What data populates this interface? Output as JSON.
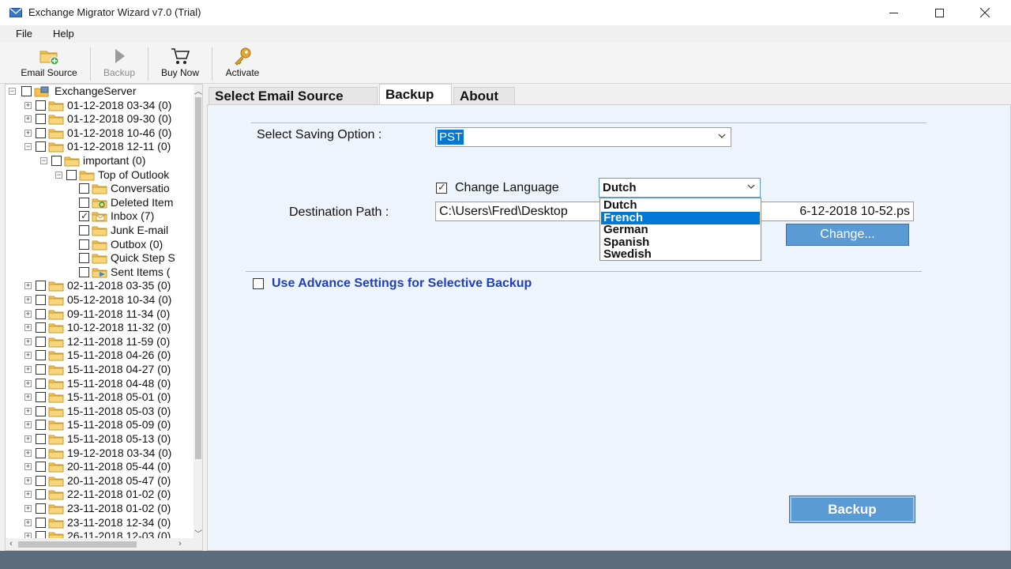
{
  "window": {
    "title": "Exchange Migrator Wizard v7.0 (Trial)"
  },
  "menu": {
    "file": "File",
    "help": "Help"
  },
  "toolbar": {
    "email_source": "Email Source",
    "backup": "Backup",
    "buy_now": "Buy Now",
    "activate": "Activate"
  },
  "tree": {
    "root": "ExchangeServer",
    "nodes": [
      {
        "label": "01-12-2018 03-34 (0)",
        "level": 1,
        "expander": "+",
        "checked": false
      },
      {
        "label": "01-12-2018 09-30 (0)",
        "level": 1,
        "expander": "+",
        "checked": false
      },
      {
        "label": "01-12-2018 10-46 (0)",
        "level": 1,
        "expander": "+",
        "checked": false
      },
      {
        "label": "01-12-2018 12-11 (0)",
        "level": 1,
        "expander": "-",
        "checked": false
      },
      {
        "label": "important (0)",
        "level": 2,
        "expander": "-",
        "checked": false
      },
      {
        "label": "Top of Outlook",
        "level": 3,
        "expander": "-",
        "checked": false
      },
      {
        "label": "Conversatio",
        "level": 4,
        "expander": "",
        "checked": false
      },
      {
        "label": "Deleted Item",
        "level": 4,
        "expander": "",
        "checked": false,
        "icon": "recycle"
      },
      {
        "label": "Inbox (7)",
        "level": 4,
        "expander": "",
        "checked": true,
        "icon": "mail"
      },
      {
        "label": "Junk E-mail",
        "level": 4,
        "expander": "",
        "checked": false
      },
      {
        "label": "Outbox (0)",
        "level": 4,
        "expander": "",
        "checked": false
      },
      {
        "label": "Quick Step S",
        "level": 4,
        "expander": "",
        "checked": false
      },
      {
        "label": "Sent Items (",
        "level": 4,
        "expander": "",
        "checked": false,
        "icon": "sent"
      },
      {
        "label": "02-11-2018 03-35 (0)",
        "level": 1,
        "expander": "+",
        "checked": false
      },
      {
        "label": "05-12-2018 10-34 (0)",
        "level": 1,
        "expander": "+",
        "checked": false
      },
      {
        "label": "09-11-2018 11-34 (0)",
        "level": 1,
        "expander": "+",
        "checked": false
      },
      {
        "label": "10-12-2018 11-32 (0)",
        "level": 1,
        "expander": "+",
        "checked": false
      },
      {
        "label": "12-11-2018 11-59 (0)",
        "level": 1,
        "expander": "+",
        "checked": false
      },
      {
        "label": "15-11-2018 04-26 (0)",
        "level": 1,
        "expander": "+",
        "checked": false
      },
      {
        "label": "15-11-2018 04-27 (0)",
        "level": 1,
        "expander": "+",
        "checked": false
      },
      {
        "label": "15-11-2018 04-48 (0)",
        "level": 1,
        "expander": "+",
        "checked": false
      },
      {
        "label": "15-11-2018 05-01 (0)",
        "level": 1,
        "expander": "+",
        "checked": false
      },
      {
        "label": "15-11-2018 05-03 (0)",
        "level": 1,
        "expander": "+",
        "checked": false
      },
      {
        "label": "15-11-2018 05-09 (0)",
        "level": 1,
        "expander": "+",
        "checked": false
      },
      {
        "label": "15-11-2018 05-13 (0)",
        "level": 1,
        "expander": "+",
        "checked": false
      },
      {
        "label": "19-12-2018 03-34 (0)",
        "level": 1,
        "expander": "+",
        "checked": false
      },
      {
        "label": "20-11-2018 05-44 (0)",
        "level": 1,
        "expander": "+",
        "checked": false
      },
      {
        "label": "20-11-2018 05-47 (0)",
        "level": 1,
        "expander": "+",
        "checked": false
      },
      {
        "label": "22-11-2018 01-02 (0)",
        "level": 1,
        "expander": "+",
        "checked": false
      },
      {
        "label": "23-11-2018 01-02 (0)",
        "level": 1,
        "expander": "+",
        "checked": false
      },
      {
        "label": "23-11-2018 12-34 (0)",
        "level": 1,
        "expander": "+",
        "checked": false
      },
      {
        "label": "26-11-2018 12-03 (0)",
        "level": 1,
        "expander": "+",
        "checked": false
      }
    ]
  },
  "tabs": {
    "select_email_source": "Select Email Source",
    "backup": "Backup",
    "about": "About",
    "active": "Backup"
  },
  "backup_panel": {
    "saving_option_label": "Select Saving Option :",
    "saving_option_value": "PST",
    "change_language_label": "Change Language",
    "change_language_checked": true,
    "language_value": "Dutch",
    "language_options": [
      "Dutch",
      "French",
      "German",
      "Spanish",
      "Swedish"
    ],
    "language_highlighted": "French",
    "destination_label": "Destination Path :",
    "destination_value_start": "C:\\Users\\Fred\\Desktop",
    "destination_value_end": "6-12-2018 10-52.ps",
    "change_button": "Change...",
    "advance_settings_label": "Use Advance Settings for Selective Backup",
    "advance_settings_checked": false,
    "backup_button": "Backup"
  },
  "colors": {
    "accent": "#0078d7",
    "button": "#5a9bd5",
    "advance_text": "#1f3fc0",
    "status_bar": "#5b6d7c"
  }
}
